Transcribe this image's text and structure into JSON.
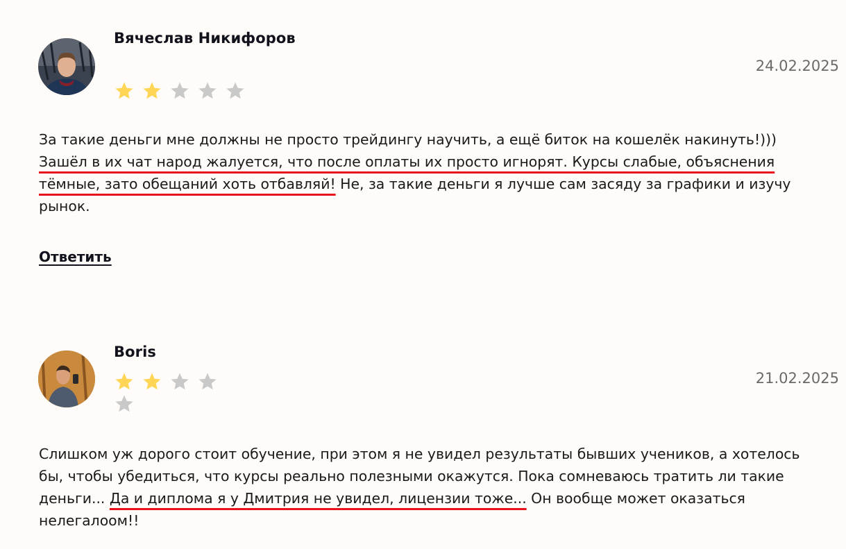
{
  "colors": {
    "star_filled": "#ffd556",
    "star_empty": "#c9c9c9",
    "highlight_underline": "#e8121b"
  },
  "reviews": [
    {
      "author": "Вячеслав Никифоров",
      "date": "24.02.2025",
      "rating": 2,
      "max_rating": 5,
      "text_parts": [
        "За такие деньги мне должны не просто трейдингу научить, а ещё биток на кошелёк накинуть!))) ",
        "Зашёл в их чат народ жалуется, что после оплаты их просто игнорят. Курсы слабые, объяснения тёмные, зато обещаний хоть отбавляй!",
        " Не, за такие деньги я лучше сам засяду за графики и изучу рынок."
      ],
      "reply_label": "Ответить"
    },
    {
      "author": "Boris",
      "date": "21.02.2025",
      "rating": 2,
      "max_rating": 5,
      "text_parts": [
        "Слишком уж дорого стоит обучение, при этом я не увидел результаты бывших учеников, а хотелось бы, чтобы убедиться, что курсы реально полезными окажутся. Пока сомневаюсь тратить ли такие деньги... ",
        "Да и диплома я у Дмитрия не увидел, лицензии тоже...",
        " Он вообще может оказаться нелегалоом!!"
      ]
    }
  ]
}
